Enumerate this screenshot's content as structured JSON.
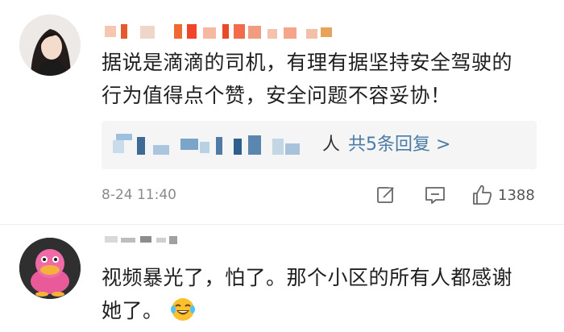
{
  "comments": [
    {
      "text": "据说是滴滴的司机，有理有据坚持安全驾驶的\n行为值得点个赞，安全问题不容妥协！",
      "replies": {
        "suffix": "人",
        "link": "共5条回复 >"
      },
      "timestamp": "8-24 11:40",
      "like_count": "1388",
      "icons": {
        "share": "share-edit-icon",
        "reply": "comment-icon",
        "like": "thumbs-up-icon"
      }
    },
    {
      "text": "视频暴光了，怕了。那个小区的所有人都感谢\n她了。",
      "emoji": "laughing-tears-emoji"
    }
  ],
  "colors": {
    "link": "#4a7ba6",
    "meta": "#8a8a8a",
    "reply_bg": "#f5f5f5",
    "text": "#1f1f1f"
  }
}
